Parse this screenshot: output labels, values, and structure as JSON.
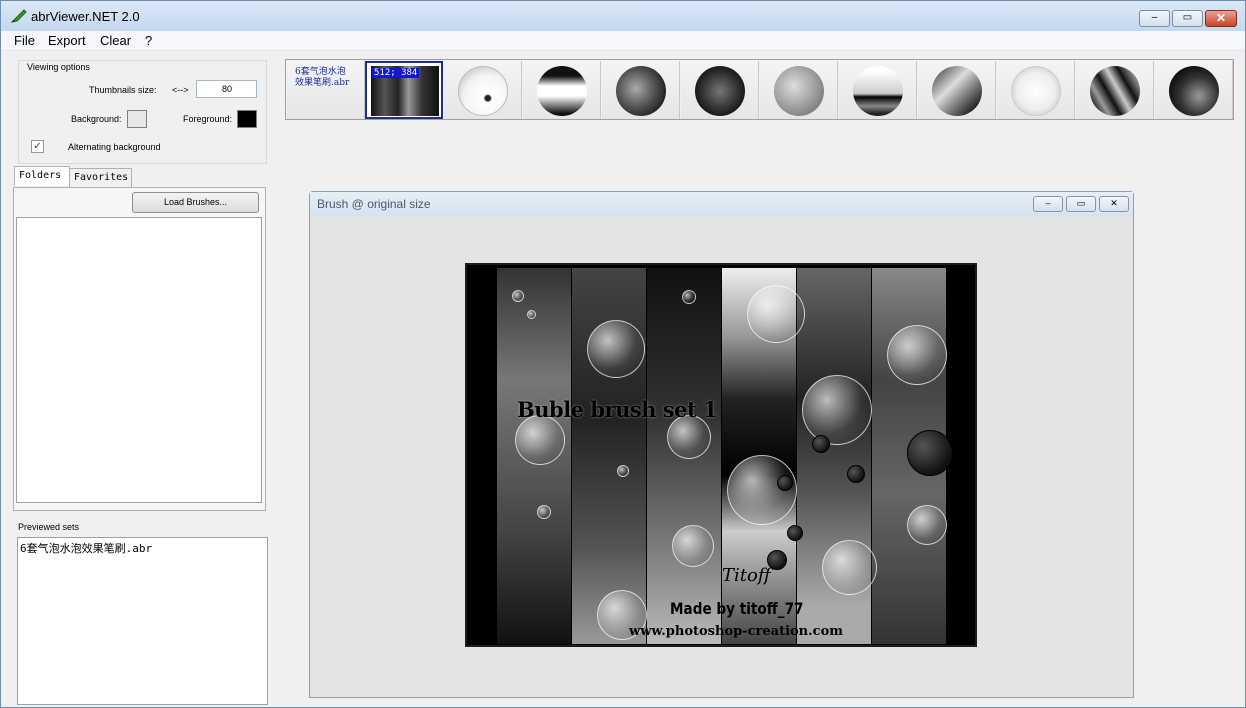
{
  "app": {
    "title": "abrViewer.NET 2.0"
  },
  "window_controls": {
    "minimize": "‒",
    "maximize": "▭",
    "close": "✕"
  },
  "menu": [
    "File",
    "Export",
    "Clear",
    "?"
  ],
  "viewing_options": {
    "legend": "Viewing options",
    "thumb_size_label": "Thumbnails size:",
    "thumb_size_arrow": "<-->",
    "thumb_size_value": "80",
    "background_label": "Background:",
    "background_color": "#e8e8e8",
    "foreground_label": "Foreground:",
    "foreground_color": "#000000",
    "alternating_label": "Alternating background",
    "alternating_checked": "✓"
  },
  "tabs": [
    "Folders",
    "Favorites"
  ],
  "load_button": "Load Brushes...",
  "previewed": {
    "label": "Previewed sets",
    "items": [
      "6套气泡水泡效果笔刷.abr"
    ]
  },
  "thumbnails": {
    "set_name_line1": "6套气泡水泡",
    "set_name_line2": "效果笔刷.abr",
    "selected_size": "512; 384"
  },
  "preview_window": {
    "title": "Brush @ original size",
    "brush_title": "Buble brush set 1",
    "brush_signature": "Titoff",
    "brush_credit": "Made by titoff_77",
    "brush_url": "www.photoshop-creation.com"
  }
}
